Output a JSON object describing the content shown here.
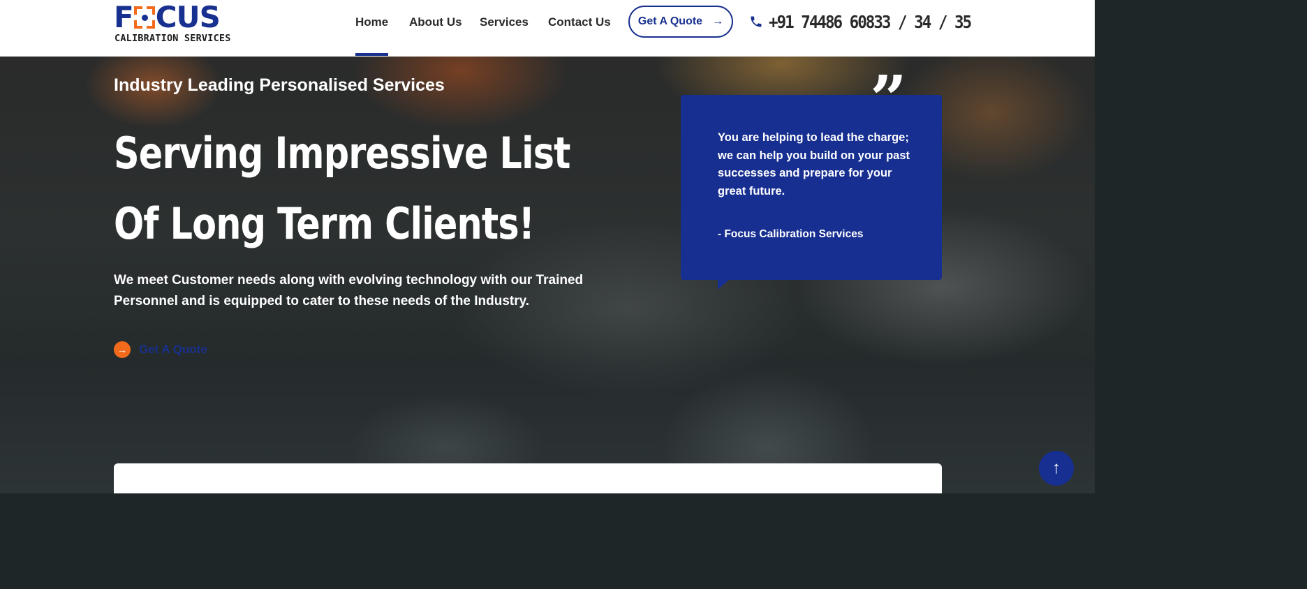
{
  "header": {
    "logo": {
      "word_start": "F",
      "word_end": "CUS",
      "tagline": "CALIBRATION SERVICES"
    },
    "nav": [
      {
        "label": "Home",
        "active": true
      },
      {
        "label": "About Us",
        "active": false
      },
      {
        "label": "Services",
        "active": false
      },
      {
        "label": "Contact Us",
        "active": false
      }
    ],
    "quote_button": "Get A Quote",
    "phone": "+91 74486 60833 / 34 / 35",
    "icons": {
      "phone": "phone-icon",
      "arrow": "arrow-right-icon"
    }
  },
  "hero": {
    "subtitle": "Industry Leading Personalised Services",
    "title_lines": [
      "Serving Impressive List",
      "Of Long Term Clients!"
    ],
    "description": "We meet Customer needs along with evolving technology with our Trained Personnel and is equipped to cater to these needs of the Industry.",
    "cta_label": "Get A Quote"
  },
  "testimonial": {
    "quote_mark": "”",
    "text": "You are helping to lead the charge; we can help you build on your past successes and prepare for your great future.",
    "author": "- Focus Calibration Services"
  },
  "colors": {
    "brand_blue": "#18308f",
    "accent_orange": "#f26a1b",
    "card_blue": "#172f91"
  },
  "scroll_top_icon": "arrow-up-icon"
}
